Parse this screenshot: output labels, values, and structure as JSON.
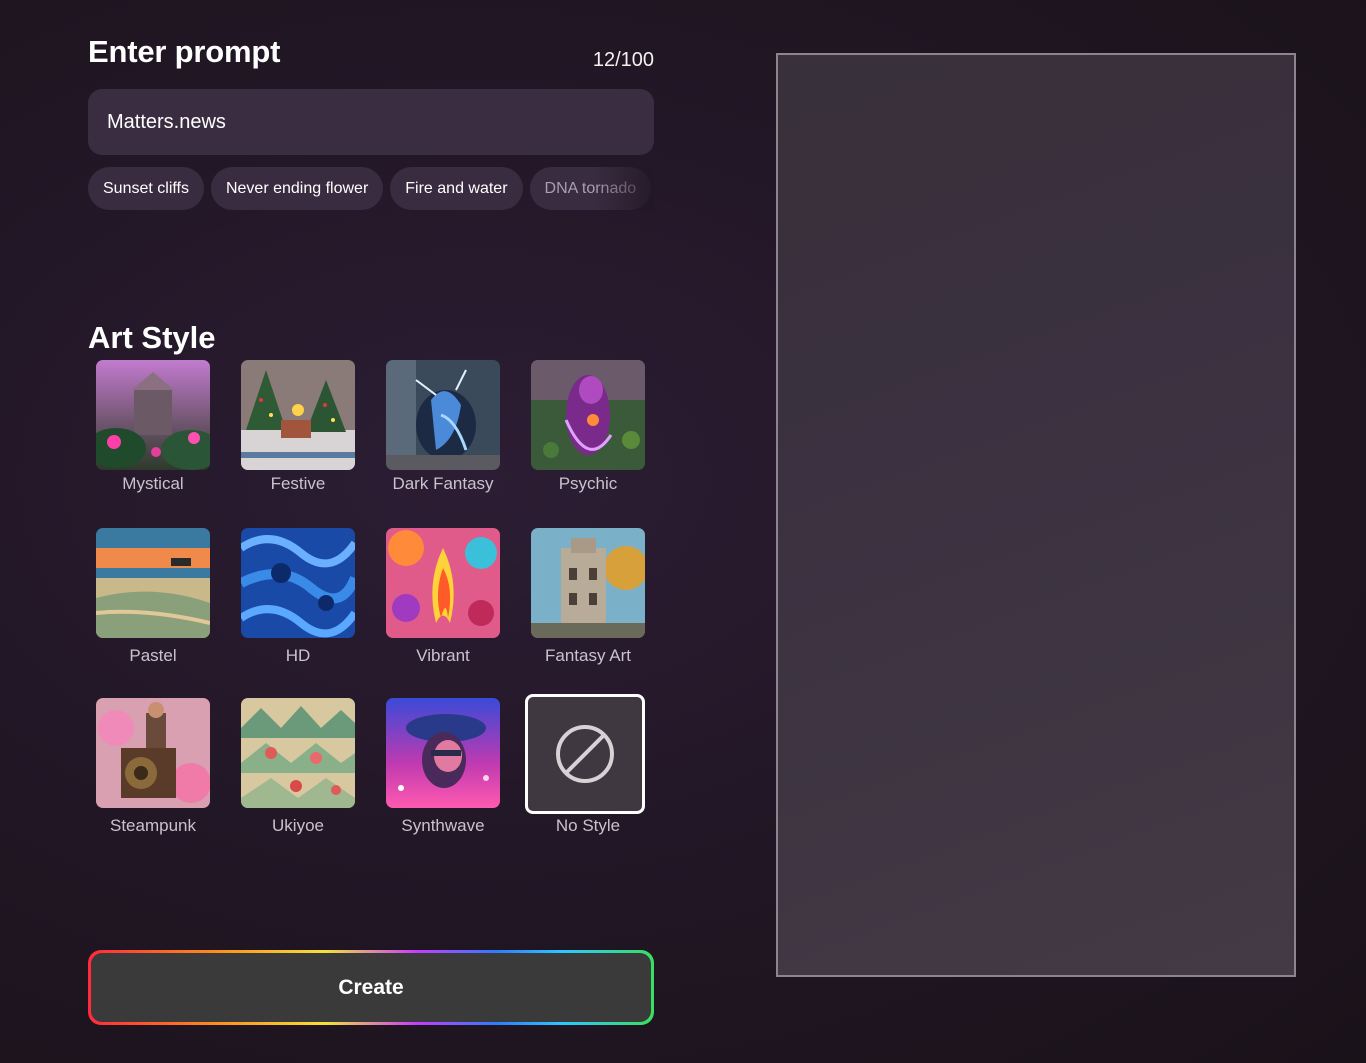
{
  "prompt": {
    "title": "Enter prompt",
    "counter": "12/100",
    "value": "Matters.news"
  },
  "suggestions": [
    {
      "label": "Sunset cliffs"
    },
    {
      "label": "Never ending flower"
    },
    {
      "label": "Fire and water"
    },
    {
      "label": "DNA tornado"
    }
  ],
  "art_style": {
    "title": "Art Style",
    "selected": "No Style",
    "styles": [
      {
        "label": "Mystical"
      },
      {
        "label": "Festive"
      },
      {
        "label": "Dark Fantasy"
      },
      {
        "label": "Psychic"
      },
      {
        "label": "Pastel"
      },
      {
        "label": "HD"
      },
      {
        "label": "Vibrant"
      },
      {
        "label": "Fantasy Art"
      },
      {
        "label": "Steampunk"
      },
      {
        "label": "Ukiyoe"
      },
      {
        "label": "Synthwave"
      },
      {
        "label": "No Style"
      }
    ]
  },
  "create_button": {
    "label": "Create"
  },
  "colors": {
    "background": "#221726",
    "input_bg": "#3a2d41",
    "chip_bg": "#3a2c40",
    "button_bg": "#3a3a3a",
    "preview_bg": "#3b3140"
  }
}
